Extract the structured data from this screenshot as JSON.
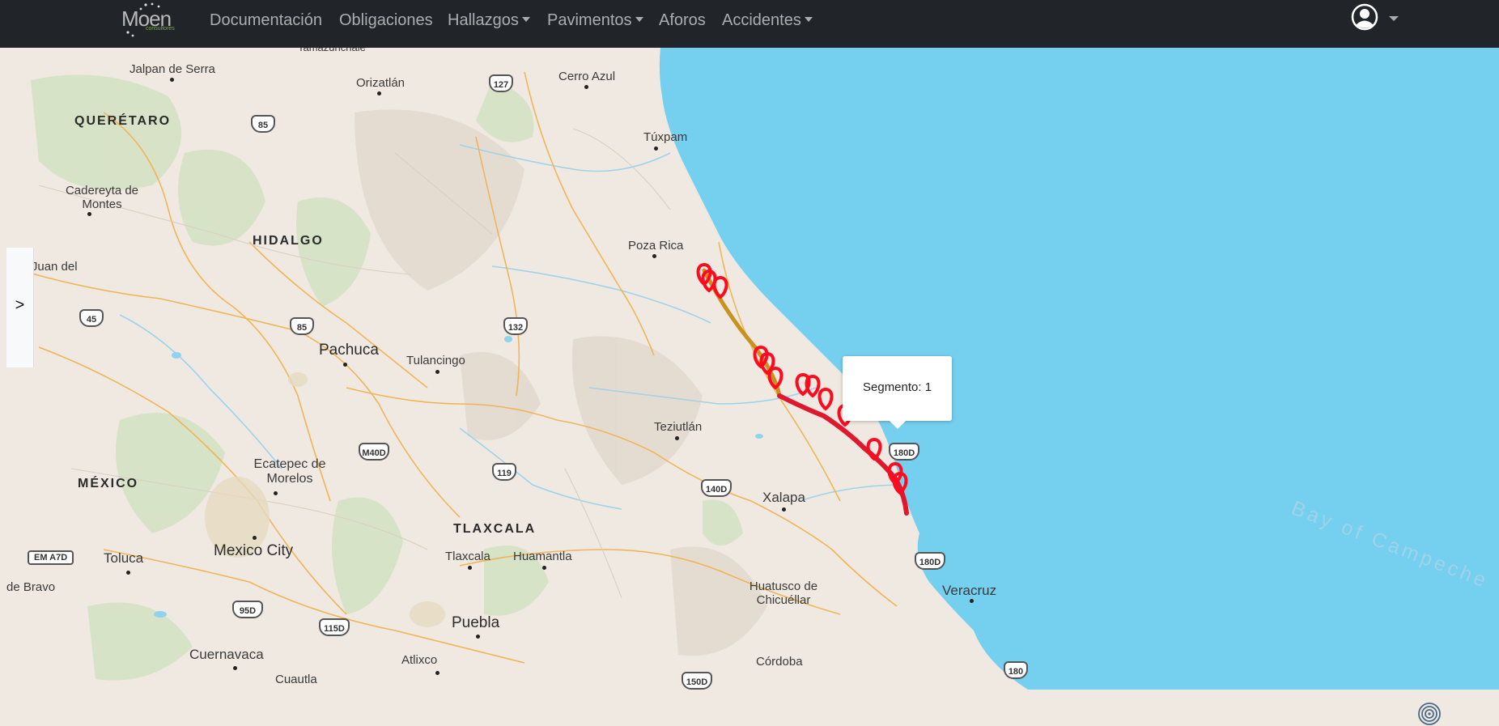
{
  "navbar": {
    "brand": "Moen",
    "brand_sub": "consultores",
    "items": [
      {
        "label": "Documentación",
        "dropdown": false
      },
      {
        "label": "Obligaciones",
        "dropdown": false
      },
      {
        "label": "Hallazgos",
        "dropdown": true
      },
      {
        "label": "Pavimentos",
        "dropdown": true
      },
      {
        "label": "Aforos",
        "dropdown": false
      },
      {
        "label": "Accidentes",
        "dropdown": true
      }
    ],
    "user_icon": "user-circle-icon"
  },
  "map": {
    "sidebar_toggle": ">",
    "popup": {
      "text": "Segmento: 1"
    },
    "sea_label": "Bay of Campeche",
    "states": [
      "QUERÉTARO",
      "HIDALGO",
      "MÉXICO",
      "TLAXCALA"
    ],
    "cities": [
      "Jalpan de Serra",
      "Orizatlán",
      "Cerro Azul",
      "Túxpam",
      "Cadereyta de Montes",
      "San Juan del Río",
      "Poza Rica",
      "Pachuca",
      "Tulancingo",
      "Teziutlán",
      "Ecatepec de Morelos",
      "Xalapa",
      "Mexico City",
      "Toluca",
      "Tlaxcala",
      "Huamantla",
      "Huatusco de Chicuéllar",
      "Veracruz",
      "de Bravo",
      "Puebla",
      "Cuernavaca",
      "Atlixco",
      "Córdoba",
      "Cuautla",
      "Tamazunchale"
    ],
    "highways": [
      "127",
      "85",
      "45",
      "85",
      "132",
      "M40D",
      "119",
      "140D",
      "180D",
      "95D",
      "115D",
      "150D",
      "180",
      "EM A7D",
      "180D"
    ],
    "route_colors": {
      "segment_1": "#c8921f",
      "segment_2": "#e0182d",
      "marker": "#ff0a1e"
    },
    "locate_icon": "locate-icon"
  }
}
